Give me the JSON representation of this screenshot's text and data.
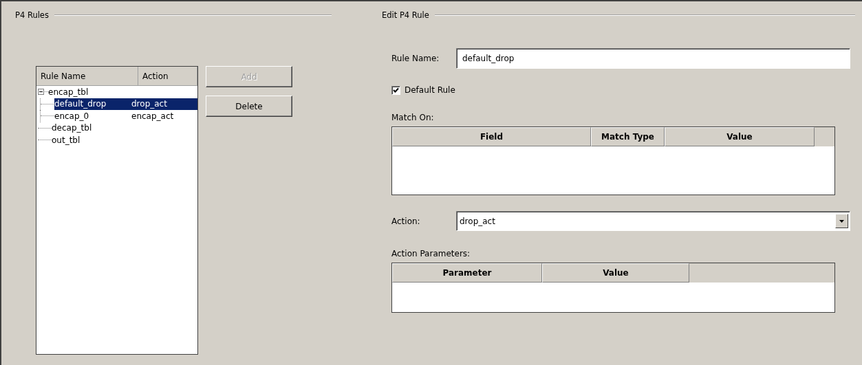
{
  "rules_panel": {
    "title": "P4 Rules",
    "tree": {
      "columns": [
        "Rule Name",
        "Action"
      ],
      "items": [
        {
          "name": "encap_tbl",
          "selected": false,
          "expanded": true,
          "children": [
            {
              "name": "default_drop",
              "action": "drop_act",
              "selected": true
            },
            {
              "name": "encap_0",
              "action": "encap_act",
              "selected": false
            }
          ]
        },
        {
          "name": "decap_tbl",
          "selected": false
        },
        {
          "name": "out_tbl",
          "selected": false
        }
      ]
    },
    "buttons": [
      {
        "label": "Add",
        "disabled": true
      },
      {
        "label": "Delete",
        "disabled": false
      }
    ]
  },
  "edit_panel": {
    "title": "Edit P4 Rule",
    "rule_name": {
      "label": "Rule Name:",
      "value": "default_drop"
    },
    "default_rule": {
      "label": "Default Rule",
      "checked": true
    },
    "match_on": {
      "label": "Match On:",
      "columns": [
        "Field",
        "Match Type",
        "Value"
      ]
    },
    "action": {
      "label": "Action:",
      "value": "drop_act"
    },
    "action_parameters": {
      "label": "Action Parameters:",
      "columns": [
        "Parameter",
        "Value"
      ]
    }
  }
}
